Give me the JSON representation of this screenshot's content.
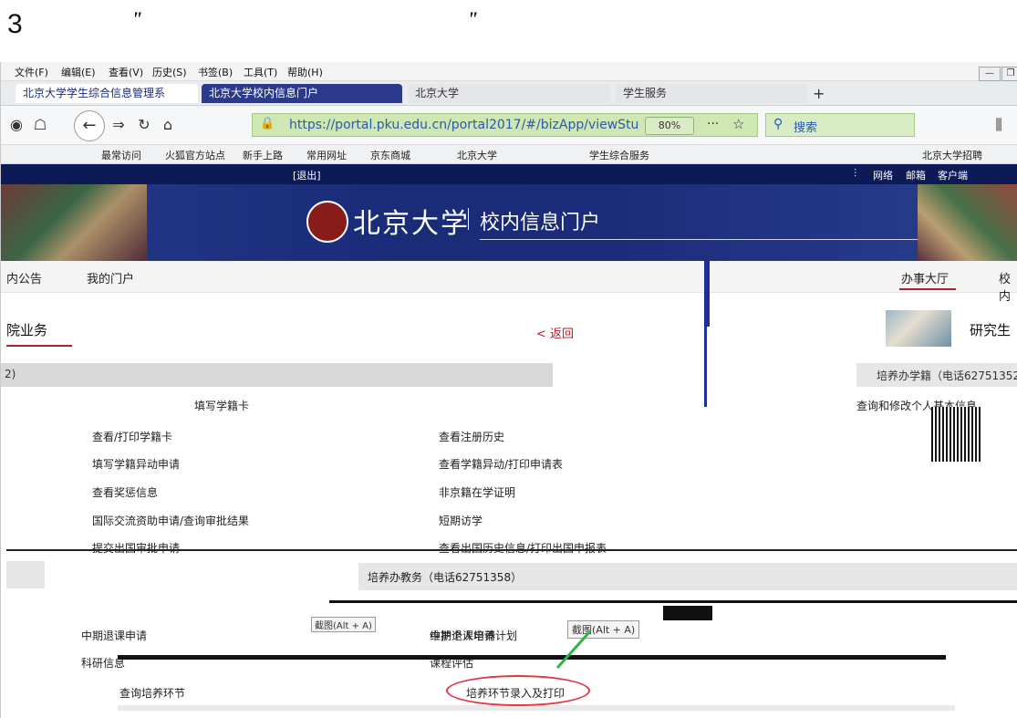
{
  "doc": {
    "heading": "3",
    "quote_open": "\"",
    "quote_close": "\""
  },
  "browser": {
    "menu": [
      "文件(F)",
      "编辑(E)",
      "查看(V)",
      "历史(S)",
      "书签(B)",
      "工具(T)",
      "帮助(H)"
    ],
    "tabs": [
      "北京大学学生综合信息管理系",
      "北京大学校内信息门户",
      "北京大学",
      "学生服务"
    ],
    "url": "https://portal.pku.edu.cn/portal2017/#/bizApp/viewStu",
    "zoom": "80%",
    "search_placeholder": "搜索",
    "bookmarks": [
      "最常访问",
      "火狐官方站点",
      "新手上路",
      "常用网址",
      "京东商城",
      "北京大学",
      "学生综合服务",
      "北京大学招聘"
    ]
  },
  "portal": {
    "logout": "[退出]",
    "top_links": [
      "网络",
      "邮箱",
      "客户端"
    ],
    "university": "北京大学",
    "portal_name": "校内信息门户",
    "subnav": {
      "left1": "内公告",
      "left2": "我的门户",
      "right1": "办事大厅",
      "right2": "校内"
    },
    "left_section": {
      "title": "院业务",
      "back": "< 返回",
      "bar_text": "2)"
    },
    "right_section": {
      "title": "研究生",
      "bar_text": "培养办学籍（电话62751352",
      "first_link": "查询和修改个人基本信息"
    },
    "xueji_links": {
      "header": "填写学籍卡",
      "col1": [
        "查看/打印学籍卡",
        "填写学籍异动申请",
        "查看奖惩信息",
        "国际交流资助申请/查询审批结果",
        "提交出国审批申请"
      ],
      "col2": [
        "查看注册历史",
        "查看学籍异动/打印申请表",
        "非京籍在学证明",
        "短期访学",
        "查看出国历史信息/打印出国申报表"
      ]
    },
    "jiaowu": {
      "bar_text": "培养办教务（电话62751358）",
      "links_left": [
        "中期退课申请",
        "科研信息",
        "查询培养环节"
      ],
      "links_right": [
        "维护个人培养计划",
        "课程评估",
        "培养环节录入及打印"
      ],
      "tooltip1": "截图(Alt + A)",
      "tooltip2": "截图(Alt + A)"
    }
  }
}
